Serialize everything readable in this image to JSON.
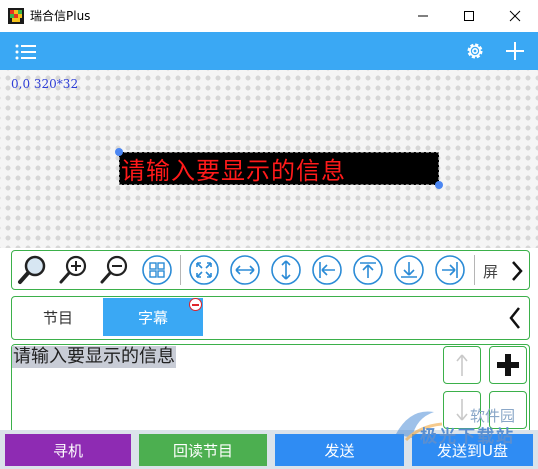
{
  "window": {
    "title": "瑞合信Plus"
  },
  "header": {
    "menu_icon": "hamburger-icon",
    "settings_icon": "gear-icon",
    "add_icon": "plus-icon"
  },
  "canvas": {
    "coord_readout": "0,0 320*32",
    "led_text": "请输入要显示的信息"
  },
  "toolbar": {
    "icons": [
      "search-icon",
      "zoom-in-icon",
      "zoom-out-icon",
      "grid-icon",
      "fit-screen-icon",
      "center-horizontal-icon",
      "center-vertical-icon",
      "align-left-icon",
      "align-top-icon",
      "align-bottom-icon",
      "align-right-icon"
    ],
    "screen_label": "屏"
  },
  "tabs": [
    {
      "label": "节目",
      "active": false
    },
    {
      "label": "字幕",
      "active": true
    }
  ],
  "editor": {
    "content": "请输入要显示的信息"
  },
  "bottom": {
    "find_label": "寻机",
    "readback_label": "回读节目",
    "send_label": "发送",
    "send_usb_label": "发送到U盘"
  },
  "watermark": {
    "line1": "软件园",
    "line2": "极光下载站"
  },
  "colors": {
    "accent": "#3aa8f4",
    "border_green": "#3bb04a",
    "find_purple": "#8e2bb3",
    "readback_green": "#4caf50",
    "send_blue": "#2f8cf3",
    "led_red": "#ff1a1a"
  }
}
